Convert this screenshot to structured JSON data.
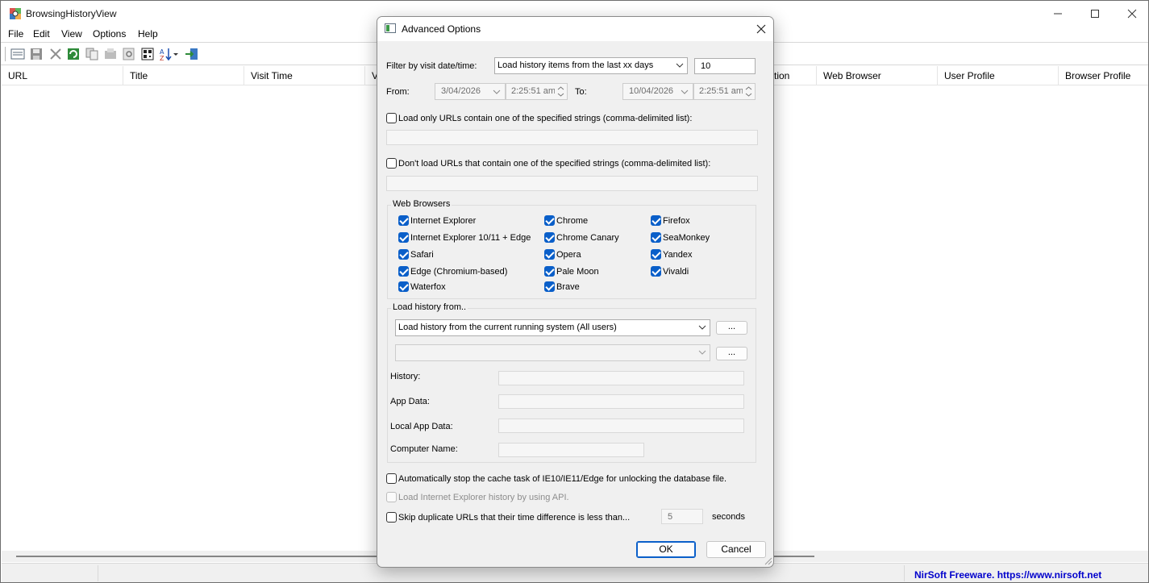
{
  "app": {
    "title": "BrowsingHistoryView",
    "menu": [
      "File",
      "Edit",
      "View",
      "Options",
      "Help"
    ],
    "columns": [
      "URL",
      "Title",
      "Visit Time",
      "V",
      "tion",
      "Web Browser",
      "User Profile",
      "Browser Profile"
    ],
    "status_link": "NirSoft Freeware. https://www.nirsoft.net"
  },
  "dialog": {
    "title": "Advanced Options",
    "filter_label": "Filter by visit date/time:",
    "filter_value": "Load history items from the last xx days",
    "days_value": "10",
    "from_label": "From:",
    "from_date": "3/04/2026",
    "from_time": "2:25:51 am",
    "to_label": "To:",
    "to_date": "10/04/2026",
    "to_time": "2:25:51 am",
    "load_only_label": "Load only URLs contain one of the specified strings (comma-delimited list):",
    "dont_load_label": "Don't load URLs that contain one of the specified strings (comma-delimited list):",
    "browsers_title": "Web Browsers",
    "browsers": [
      "Internet Explorer",
      "Chrome",
      "Firefox",
      "Internet Explorer 10/11 + Edge",
      "Chrome Canary",
      "SeaMonkey",
      "Safari",
      "Opera",
      "Yandex",
      "Edge (Chromium-based)",
      "Pale Moon",
      "Vivaldi",
      "Waterfox",
      "Brave"
    ],
    "load_from_title": "Load history from..",
    "load_from_value": "Load history from the current running system (All users)",
    "browse_label": "...",
    "history_label": "History:",
    "appdata_label": "App Data:",
    "localappdata_label": "Local App Data:",
    "computer_label": "Computer Name:",
    "auto_stop_label": "Automatically stop the cache task of IE10/IE11/Edge for unlocking the database file.",
    "ie_api_label": "Load Internet Explorer history by using API.",
    "skip_dup_label": "Skip duplicate URLs that their time difference is less than...",
    "skip_dup_value": "5",
    "seconds_label": "seconds",
    "ok_label": "OK",
    "cancel_label": "Cancel"
  },
  "colors": {
    "accent": "#0a5fc9",
    "link": "#0000cc"
  }
}
